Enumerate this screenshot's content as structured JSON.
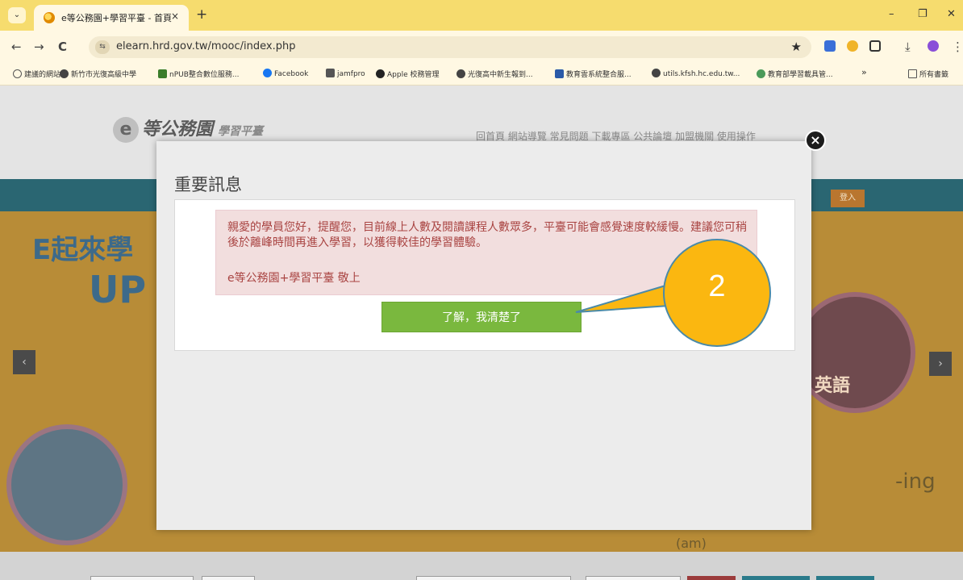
{
  "browser": {
    "tab_title": "e等公務園+學習平臺 - 首頁",
    "tab_dropdown": "⌄",
    "tab_close": "×",
    "new_tab": "+",
    "minimize": "–",
    "restore": "❐",
    "close": "✕",
    "back": "←",
    "forward": "→",
    "reload": "C",
    "url": "elearn.hrd.gov.tw/mooc/index.php",
    "star": "★",
    "download": "⤓",
    "menu": "⋮",
    "bookmarks": [
      "建議的網站",
      "新竹市光復高級中學",
      "nPUB整合數位服務...",
      "Facebook",
      "jamfpro",
      "Apple 校務管理",
      "光復高中新生報到...",
      "教育雲系統整合服...",
      "utils.kfsh.hc.edu.tw...",
      "教育部學習載具管..."
    ],
    "bookmarks_more": "»",
    "all_bookmarks": "所有書籤"
  },
  "page": {
    "logo_text": "等公務園",
    "logo_sub": "學習平臺",
    "nav": "回首頁  網站導覽  常見問題  下載專區  公共論壇  加盟機關  使用操作",
    "login": "登入",
    "banner_a": "E起來學",
    "banner_b": "UP",
    "banner_c": "英語",
    "banner_d": "-ing",
    "banner_e": "(am)",
    "arrow_left": "‹",
    "arrow_right": "›"
  },
  "modal": {
    "title": "重要訊息",
    "message": "親愛的學員您好，提醒您，目前線上人數及閱讀課程人數眾多，平臺可能會感覺速度較緩慢。建議您可稍後於離峰時間再進入學習，以獲得較佳的學習體驗。",
    "signature": "e等公務園+學習平臺 敬上",
    "confirm_label": "了解，我清楚了",
    "close_label": "×"
  },
  "callout": {
    "step": "2",
    "color": "#fbb710",
    "border": "#4a8aa8"
  }
}
